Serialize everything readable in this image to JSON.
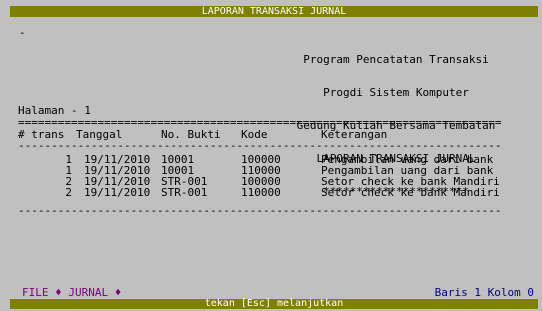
{
  "title": "LAPORAN TRANSAKSI JURNAL",
  "cursor": "-",
  "header_lines": [
    "Program Pencatatan Transaksi",
    "Progdi Sistem Komputer",
    "Gedung Kuliah Bersama Tembalan",
    "LAPORAN TRANSAKSI JURNAL",
    "**********************"
  ],
  "page_label": "Halaman - 1",
  "rule_double": "=========================================================================",
  "rule_single": "-------------------------------------------------------------------------",
  "columns": [
    "# trans",
    "Tanggal",
    "No. Bukti",
    "Kode",
    "Keterangan"
  ],
  "rows": [
    {
      "no": "1",
      "tanggal": "19/11/2010",
      "bukti": "10001",
      "kode": "100000",
      "keterangan": "Pengambilan uang dari bank"
    },
    {
      "no": "1",
      "tanggal": "19/11/2010",
      "bukti": "10001",
      "kode": "110000",
      "keterangan": "Pengambilan uang dari bank"
    },
    {
      "no": "2",
      "tanggal": "19/11/2010",
      "bukti": "STR-001",
      "kode": "100000",
      "keterangan": "Setor check ke bank Mandiri"
    },
    {
      "no": "2",
      "tanggal": "19/11/2010",
      "bukti": "STR-001",
      "kode": "110000",
      "keterangan": "Setor check ke bank Mandiri"
    }
  ],
  "menu": {
    "file": "FILE",
    "jurnal": "JURNAL",
    "sep": "♦"
  },
  "cursor_pos": "Baris 1 Kolom 0",
  "footer": "tekan [Esc] melanjutkan",
  "colors": {
    "titlebar": "#808000",
    "background": "#c0c0c0",
    "menu": "#800080",
    "status": "#000080"
  }
}
